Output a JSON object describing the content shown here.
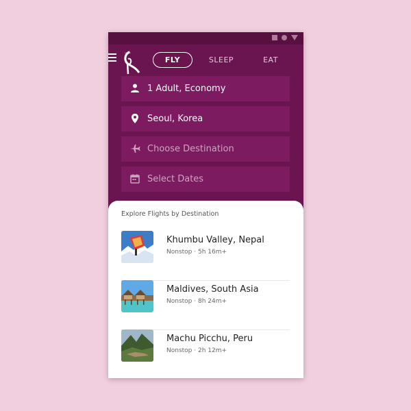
{
  "tabs": {
    "fly": "FLY",
    "sleep": "SLEEP",
    "eat": "EAT",
    "active": "fly"
  },
  "fields": {
    "travelers": "1 Adult, Economy",
    "origin": "Seoul, Korea",
    "destination_placeholder": "Choose Destination",
    "dates_placeholder": "Select Dates"
  },
  "explore": {
    "title": "Explore Flights by Destination",
    "destinations": [
      {
        "name": "Khumbu Valley, Nepal",
        "info": "Nonstop · 5h 16m+"
      },
      {
        "name": "Maldives, South Asia",
        "info": "Nonstop · 8h 24m+"
      },
      {
        "name": "Machu Picchu, Peru",
        "info": "Nonstop · 2h 12m+"
      }
    ]
  },
  "colors": {
    "page_background": "#f2cfdf",
    "app_background": "#6a1550",
    "field_background": "#7d1b60",
    "sheet_background": "#ffffff"
  },
  "icons": [
    "menu-icon",
    "crane-logo-icon",
    "person-icon",
    "location-pin-icon",
    "plane-icon",
    "calendar-icon"
  ]
}
